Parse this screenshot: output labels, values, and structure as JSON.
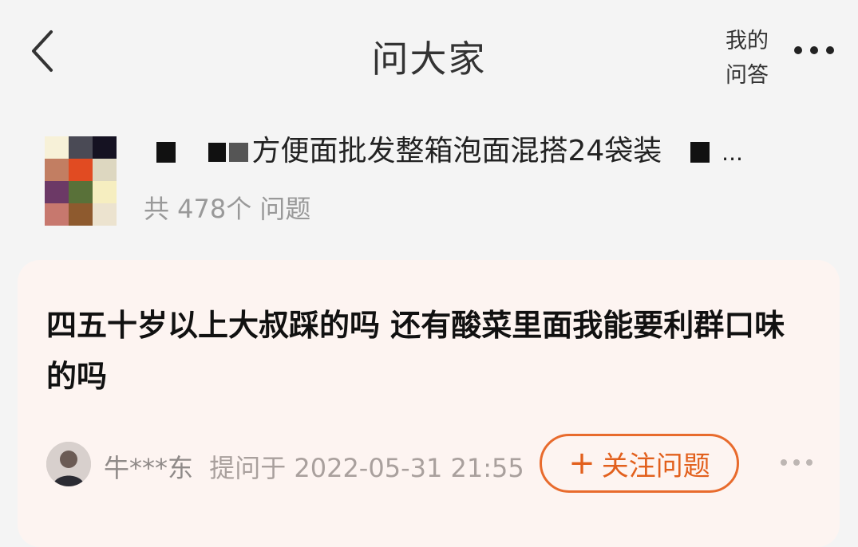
{
  "header": {
    "title": "问大家",
    "my_questions_line1": "我的",
    "my_questions_line2": "问答"
  },
  "product": {
    "name": "方便面批发整箱泡面混搭24袋装",
    "ellipsis": "...",
    "question_count": "共 478个 问题"
  },
  "question_card": {
    "question_text": "四五十岁以上大叔踩的吗  还有酸菜里面我能要利群口味的吗",
    "user": "牛***东",
    "asked_at": "提问于 2022-05-31 21:55",
    "follow_label": "关注问题",
    "follow_plus": "+"
  },
  "colors": {
    "accent": "#e86b2d",
    "card_bg": "#fdf4f1",
    "page_bg": "#f4f4f4"
  },
  "icons": [
    "back-arrow-icon",
    "more-dots-icon",
    "plus-icon"
  ]
}
